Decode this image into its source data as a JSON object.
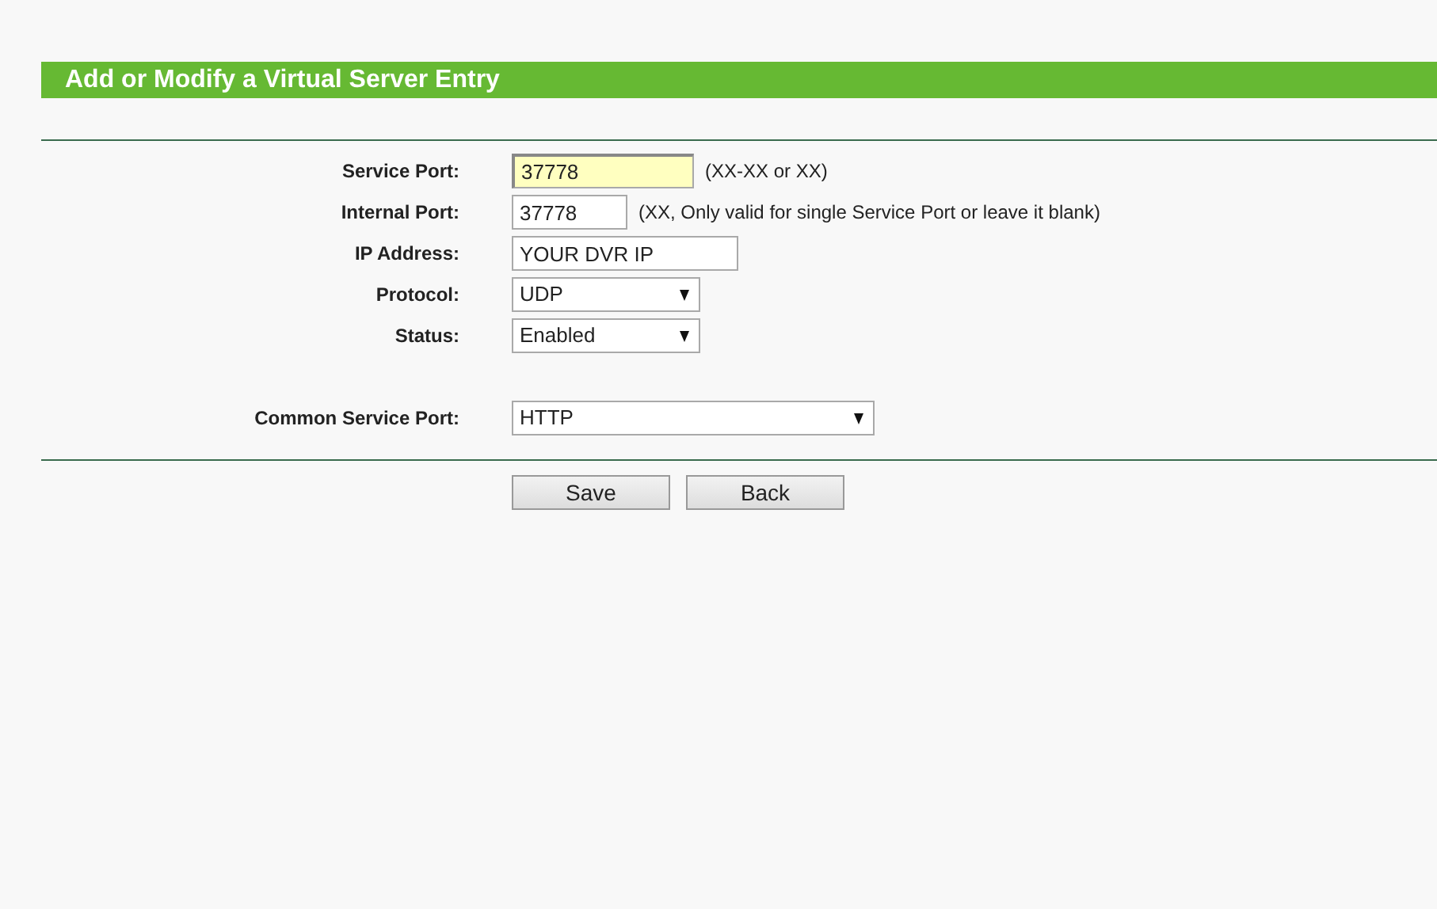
{
  "header": {
    "title": "Add or Modify a Virtual Server Entry"
  },
  "fields": [
    {
      "label": "Service Port:",
      "kind": "text",
      "value": "37778",
      "highlighted": true,
      "hint": "(XX-XX or XX)"
    },
    {
      "label": "Internal Port:",
      "kind": "text",
      "value": "37778",
      "highlighted": false,
      "hint": "(XX, Only valid for single Service Port or leave it blank)"
    },
    {
      "label": "IP Address:",
      "kind": "text",
      "value": "YOUR DVR IP",
      "highlighted": false
    },
    {
      "label": "Protocol:",
      "kind": "select",
      "value": "UDP",
      "highlighted": false
    },
    {
      "label": "Status:",
      "kind": "select",
      "value": "Enabled",
      "highlighted": false
    },
    {
      "label": "Common Service Port:",
      "kind": "select",
      "value": "HTTP",
      "highlighted": false,
      "gap_before": true
    }
  ],
  "buttons": [
    "Save",
    "Back"
  ]
}
